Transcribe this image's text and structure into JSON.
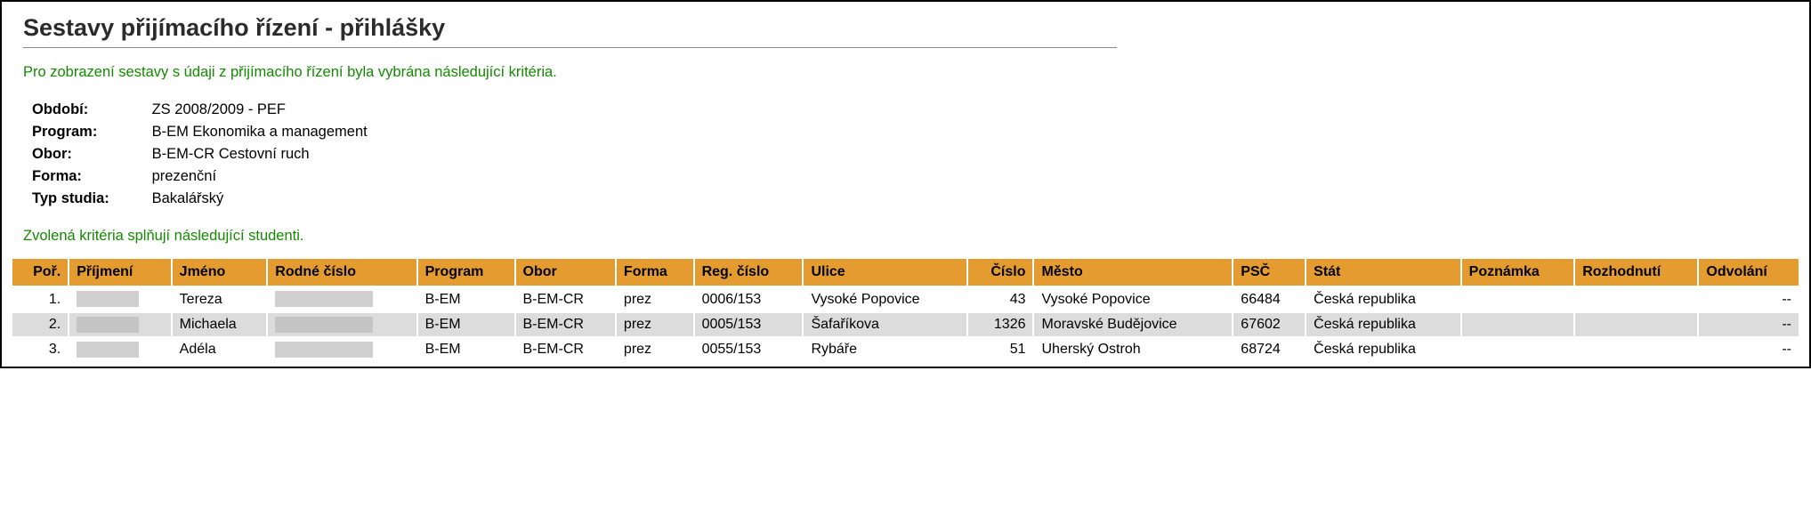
{
  "page_title": "Sestavy přijímacího řízení - přihlášky",
  "intro_note": "Pro zobrazení sestavy s údaji z přijímacího řízení byla vybrána následující kritéria.",
  "criteria": {
    "obdobi_label": "Období:",
    "obdobi_value": "ZS 2008/2009 - PEF",
    "program_label": "Program:",
    "program_value": "B-EM Ekonomika a management",
    "obor_label": "Obor:",
    "obor_value": "B-EM-CR Cestovní ruch",
    "forma_label": "Forma:",
    "forma_value": "prezenční",
    "typ_label": "Typ studia:",
    "typ_value": "Bakalářský"
  },
  "students_note": "Zvolená kritéria splňují následující studenti.",
  "columns": {
    "por": "Poř.",
    "prijmeni": "Příjmení",
    "jmeno": "Jméno",
    "rodne_cislo": "Rodné číslo",
    "program": "Program",
    "obor": "Obor",
    "forma": "Forma",
    "reg_cislo": "Reg. číslo",
    "ulice": "Ulice",
    "cislo": "Číslo",
    "mesto": "Město",
    "psc": "PSČ",
    "stat": "Stát",
    "poznamka": "Poznámka",
    "rozhodnuti": "Rozhodnutí",
    "odvolani": "Odvolání"
  },
  "rows": [
    {
      "por": "1.",
      "prijmeni": "",
      "jmeno": "Tereza",
      "rodne_cislo": "",
      "program": "B-EM",
      "obor": "B-EM-CR",
      "forma": "prez",
      "reg_cislo": "0006/153",
      "ulice": "Vysoké Popovice",
      "cislo": "43",
      "mesto": "Vysoké Popovice",
      "psc": "66484",
      "stat": "Česká republika",
      "poznamka": "",
      "rozhodnuti": "",
      "odvolani": "--"
    },
    {
      "por": "2.",
      "prijmeni": "",
      "jmeno": "Michaela",
      "rodne_cislo": "",
      "program": "B-EM",
      "obor": "B-EM-CR",
      "forma": "prez",
      "reg_cislo": "0005/153",
      "ulice": "Šafaříkova",
      "cislo": "1326",
      "mesto": "Moravské Budějovice",
      "psc": "67602",
      "stat": "Česká republika",
      "poznamka": "",
      "rozhodnuti": "",
      "odvolani": "--"
    },
    {
      "por": "3.",
      "prijmeni": "",
      "jmeno": "Adéla",
      "rodne_cislo": "",
      "program": "B-EM",
      "obor": "B-EM-CR",
      "forma": "prez",
      "reg_cislo": "0055/153",
      "ulice": "Rybáře",
      "cislo": "51",
      "mesto": "Uherský Ostroh",
      "psc": "68724",
      "stat": "Česká republika",
      "poznamka": "",
      "rozhodnuti": "",
      "odvolani": "--"
    }
  ]
}
